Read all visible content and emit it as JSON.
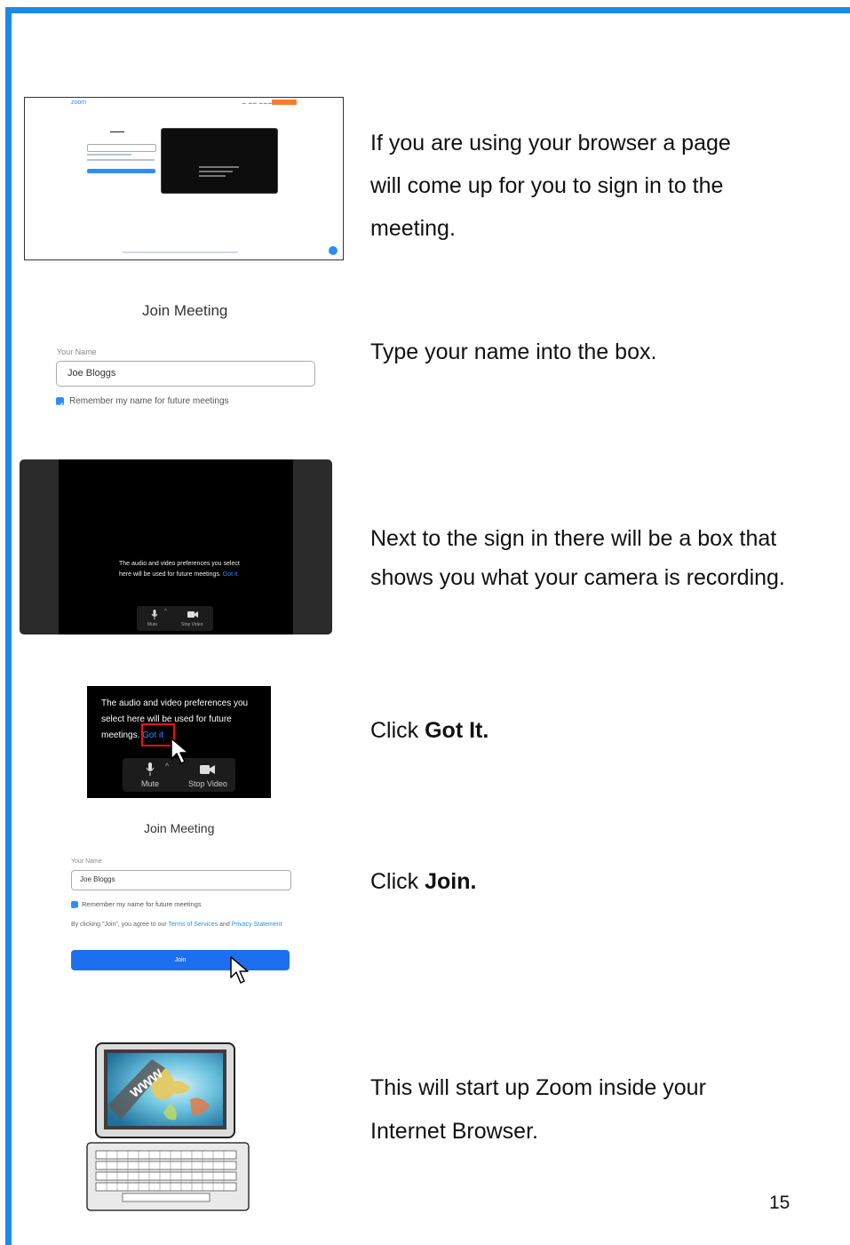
{
  "steps": [
    {
      "line1": "If you are using your browser a page",
      "line2": "will come up for you to sign in to the",
      "line3": "meeting."
    },
    {
      "line1": "Type your name into the box."
    },
    {
      "line1": "Next to the sign in there will be a box that",
      "line2": "shows you what your camera is recording."
    },
    {
      "prefix": "Click ",
      "bold": "Got It."
    },
    {
      "prefix": "Click ",
      "bold": "Join."
    },
    {
      "line1": "This will start up Zoom inside your",
      "line2": "Internet Browser."
    }
  ],
  "page_number": "15",
  "shot1": {
    "logo": "zoom"
  },
  "join_form": {
    "title": "Join Meeting",
    "name_label": "Your Name",
    "name_value": "Joe Bloggs",
    "remember_label": "Remember my name for future meetings"
  },
  "camera_tip": {
    "text": "The audio and video preferences you select here will be used for future meetings.",
    "link": "Got it",
    "mute_label": "Mute",
    "stop_video_label": "Stop Video"
  },
  "join_form_small": {
    "title": "Join Meeting",
    "name_label": "Your Name",
    "name_value": "Joe Bloggs",
    "remember_label": "Remember my name for future meetings",
    "terms_prefix": "By clicking \"Join\", you agree to our ",
    "terms_link": "Terms of Services",
    "terms_and": " and ",
    "privacy_link": "Privacy Statement",
    "join_button": "Join"
  },
  "illustration": {
    "screen_text": "www"
  },
  "colors": {
    "accent": "#1e88e5",
    "zoom_blue": "#2d8cff",
    "highlight_red": "#e11111"
  }
}
